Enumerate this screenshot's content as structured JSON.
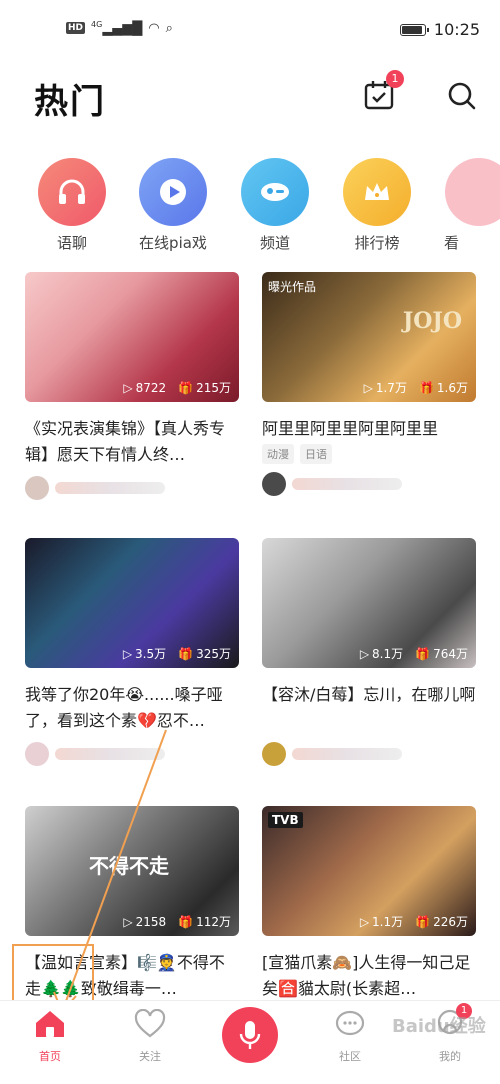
{
  "status": {
    "hd": "HD",
    "network": "4G",
    "time": "10:25"
  },
  "header": {
    "title": "热门",
    "calendar_badge": "1"
  },
  "categories": [
    {
      "label": "语聊",
      "icon": "headphones-icon",
      "color": "#f36b6b"
    },
    {
      "label": "在线pia戏",
      "icon": "play-icon",
      "color": "#6f8ff2"
    },
    {
      "label": "频道",
      "icon": "channel-icon",
      "color": "#4fb6ec"
    },
    {
      "label": "排行榜",
      "icon": "crown-icon",
      "color": "#f7c248"
    },
    {
      "label": "看",
      "icon": "more-icon",
      "color": "#f6a6b3"
    }
  ],
  "cards": [
    {
      "title": "《实况表演集锦》【真人秀专辑】愿天下有情人终…",
      "plays": "8722",
      "gifts": "215万",
      "tag": "",
      "chips": []
    },
    {
      "title": "阿里里阿里里阿里阿里里",
      "plays": "1.7万",
      "gifts": "1.6万",
      "tag": "曝光作品",
      "chips": [
        "动漫",
        "日语"
      ]
    },
    {
      "title": "我等了你20年😭......嗓子哑了，看到这个素💔忍不…",
      "plays": "3.5万",
      "gifts": "325万",
      "tag": "",
      "chips": []
    },
    {
      "title": "【容沐/白莓】忘川，在哪儿啊",
      "plays": "8.1万",
      "gifts": "764万",
      "tag": "",
      "chips": []
    },
    {
      "title": "【温如言宣素】🎼👮不得不走🌲🌲致敬缉毒一…",
      "plays": "2158",
      "gifts": "112万",
      "tag": "",
      "chips": []
    },
    {
      "title": "[宣猫爪素🙈]人生得一知己足矣🈴貓太尉(长素超…",
      "plays": "1.1万",
      "gifts": "226万",
      "tag": "",
      "chips": []
    }
  ],
  "bottom_nav": [
    {
      "label": "首页"
    },
    {
      "label": "关注"
    },
    {
      "label": "社区"
    },
    {
      "label": "我的",
      "badge": "1"
    }
  ],
  "watermark": "Baidu经验"
}
